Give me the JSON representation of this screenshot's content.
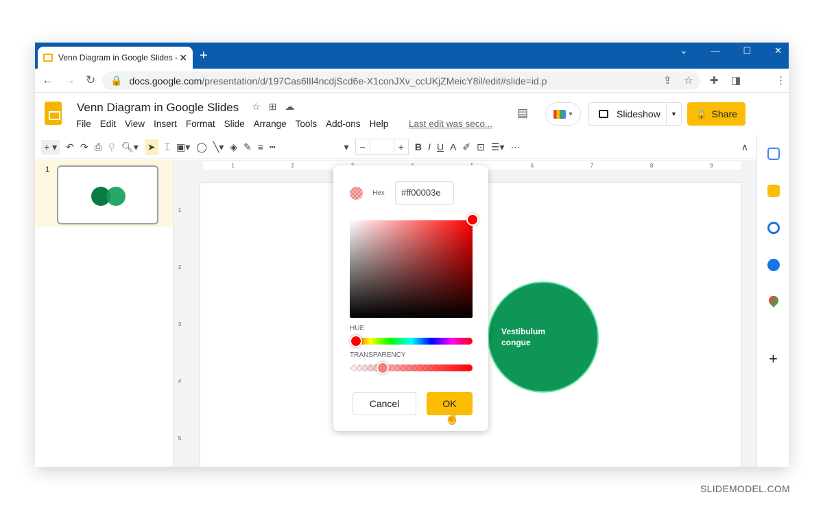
{
  "browser": {
    "tab_title": "Venn Diagram in Google Slides -",
    "url_host": "docs.google.com",
    "url_path": "/presentation/d/197Cas6lIl4ncdjScd6e-X1conJXv_ccUKjZMeicY8il/edit#slide=id.p"
  },
  "doc": {
    "title": "Venn Diagram in Google Slides",
    "menu": [
      "File",
      "Edit",
      "View",
      "Insert",
      "Format",
      "Slide",
      "Arrange",
      "Tools",
      "Add-ons",
      "Help"
    ],
    "last_edit": "Last edit was seco...",
    "slideshow": "Slideshow",
    "share": "Share"
  },
  "ruler": {
    "h": [
      "1",
      "2",
      "3",
      "4",
      "5",
      "6",
      "7",
      "8",
      "9"
    ],
    "v": [
      "1",
      "2",
      "3",
      "4",
      "5"
    ]
  },
  "filmstrip": {
    "slide_number": "1"
  },
  "slide": {
    "circle_text": "Vestibulum congue",
    "circle_color": "#0f9656"
  },
  "color_picker": {
    "hex_label": "Hex",
    "hex_value": "#ff00003e",
    "hue_label": "HUE",
    "transparency_label": "TRANSPARENCY",
    "transparency_percent": 27,
    "cancel": "Cancel",
    "ok": "OK"
  },
  "watermark": "SLIDEMODEL.COM"
}
